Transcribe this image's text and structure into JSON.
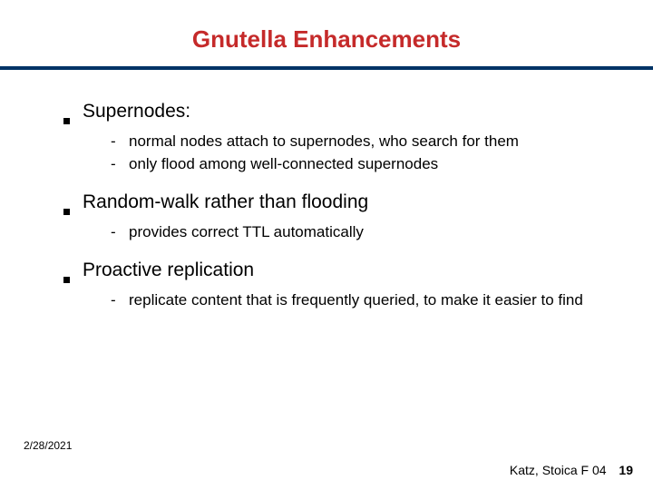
{
  "title": "Gnutella Enhancements",
  "bullets": [
    {
      "heading": "Supernodes:",
      "subs": [
        "normal nodes attach to supernodes, who search for them",
        "only flood among well-connected supernodes"
      ]
    },
    {
      "heading": "Random-walk rather than flooding",
      "subs": [
        "provides correct TTL automatically"
      ]
    },
    {
      "heading": "Proactive replication",
      "subs": [
        "replicate content that is frequently queried, to make it easier to find"
      ]
    }
  ],
  "footer": {
    "date": "2/28/2021",
    "credit": "Katz, Stoica F 04",
    "page": "19"
  }
}
